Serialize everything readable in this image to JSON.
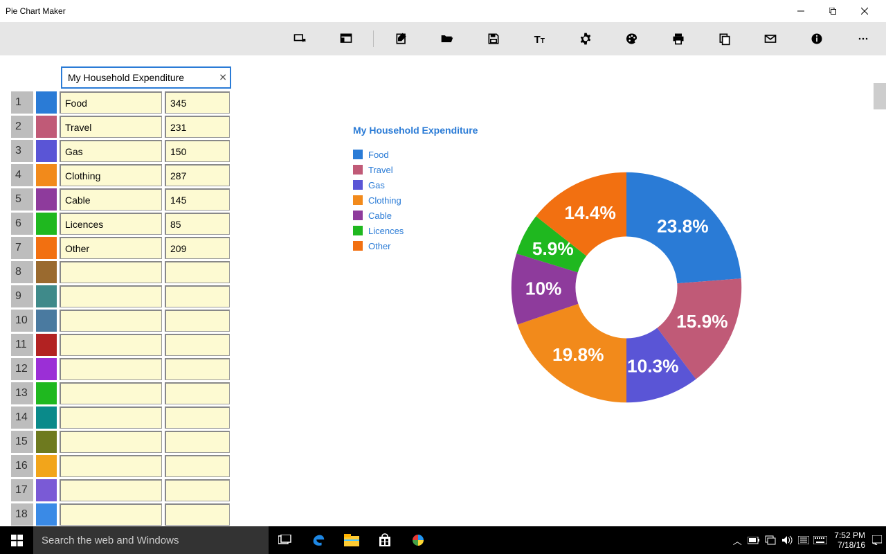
{
  "window": {
    "title": "Pie Chart Maker"
  },
  "toolbar": {
    "icons": [
      "form-icon",
      "window-icon",
      "edit-icon",
      "folder-open-icon",
      "save-icon",
      "text-icon",
      "gear-icon",
      "palette-icon",
      "print-icon",
      "copy-icon",
      "mail-icon",
      "info-icon",
      "more-icon"
    ]
  },
  "chart_title_input": "My Household Expenditure",
  "rows": [
    {
      "idx": "1",
      "color": "#2a7bd6",
      "name": "Food",
      "value": "345"
    },
    {
      "idx": "2",
      "color": "#c05a77",
      "name": "Travel",
      "value": "231"
    },
    {
      "idx": "3",
      "color": "#5a55d6",
      "name": "Gas",
      "value": "150"
    },
    {
      "idx": "4",
      "color": "#f28a1b",
      "name": "Clothing",
      "value": "287"
    },
    {
      "idx": "5",
      "color": "#8e3b9c",
      "name": "Cable",
      "value": "145"
    },
    {
      "idx": "6",
      "color": "#1fb81f",
      "name": "Licences",
      "value": "85"
    },
    {
      "idx": "7",
      "color": "#f27011",
      "name": "Other",
      "value": "209"
    },
    {
      "idx": "8",
      "color": "#9a6a2f",
      "name": "",
      "value": ""
    },
    {
      "idx": "9",
      "color": "#3f8a8a",
      "name": "",
      "value": ""
    },
    {
      "idx": "10",
      "color": "#4a7aa0",
      "name": "",
      "value": ""
    },
    {
      "idx": "11",
      "color": "#b22222",
      "name": "",
      "value": ""
    },
    {
      "idx": "12",
      "color": "#9b2fd6",
      "name": "",
      "value": ""
    },
    {
      "idx": "13",
      "color": "#1fb81f",
      "name": "",
      "value": ""
    },
    {
      "idx": "14",
      "color": "#0a8a8a",
      "name": "",
      "value": ""
    },
    {
      "idx": "15",
      "color": "#6e7a1f",
      "name": "",
      "value": ""
    },
    {
      "idx": "16",
      "color": "#f2a51b",
      "name": "",
      "value": ""
    },
    {
      "idx": "17",
      "color": "#7a5ad6",
      "name": "",
      "value": ""
    },
    {
      "idx": "18",
      "color": "#3a8ae6",
      "name": "",
      "value": ""
    }
  ],
  "chart_data": {
    "type": "pie",
    "title": "My Household Expenditure",
    "series": [
      {
        "name": "Food",
        "value": 345,
        "pct": "23.8%",
        "color": "#2a7bd6"
      },
      {
        "name": "Travel",
        "value": 231,
        "pct": "15.9%",
        "color": "#c05a77"
      },
      {
        "name": "Gas",
        "value": 150,
        "pct": "10.3%",
        "color": "#5a55d6"
      },
      {
        "name": "Clothing",
        "value": 287,
        "pct": "19.8%",
        "color": "#f28a1b"
      },
      {
        "name": "Cable",
        "value": 145,
        "pct": "10%",
        "color": "#8e3b9c"
      },
      {
        "name": "Licences",
        "value": 85,
        "pct": "5.9%",
        "color": "#1fb81f"
      },
      {
        "name": "Other",
        "value": 209,
        "pct": "14.4%",
        "color": "#f27011"
      }
    ]
  },
  "taskbar": {
    "search_placeholder": "Search the web and Windows",
    "time": "7:52 PM",
    "date": "7/18/16"
  }
}
